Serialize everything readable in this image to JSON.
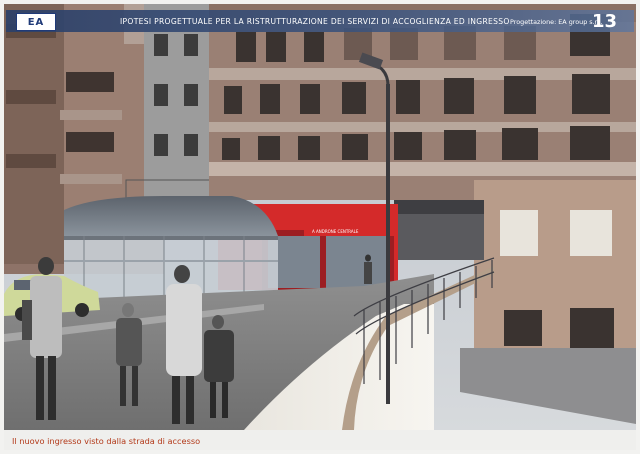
{
  "header": {
    "logo_text": "EA",
    "title": "IPOTESI PROGETTUALE PER LA RISTRUTTURAZIONE DEI SERVIZI DI ACCOGLIENZA ED INGRESSO",
    "credits": "Progettazione: EA group s.r.l.",
    "page_number": "13"
  },
  "render": {
    "entrance_sign": "A ANDRONE CENTRALE"
  },
  "caption": "Il nuovo ingresso visto dalla strada di accesso",
  "colors": {
    "header_band": "#2c4068",
    "accent_red": "#d42a2a",
    "caption_red": "#b33a1a",
    "building_brick": "#9a8074"
  }
}
